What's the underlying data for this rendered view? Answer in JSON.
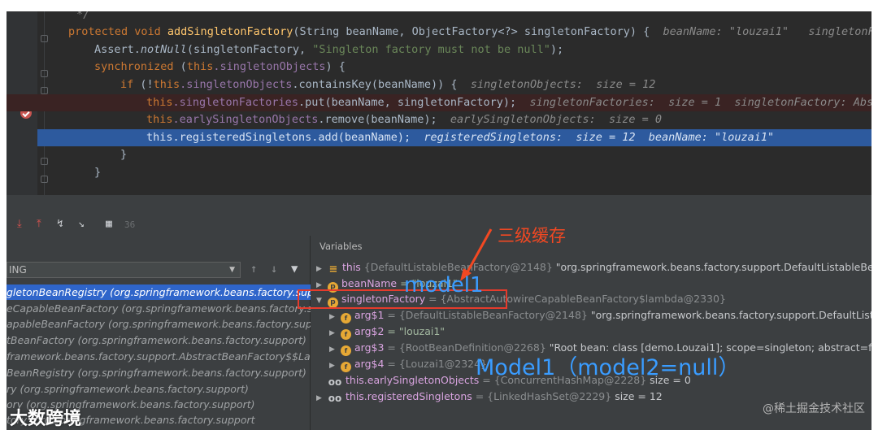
{
  "editor": {
    "lines": [
      {
        "comment": "*/"
      },
      {
        "kw": "protected void ",
        "method": "addSingletonFactory",
        "rest": "(String beanName, ObjectFactory<?> singletonFactory) {",
        "hint": "beanName: \"louzai1\"   singletonFacto"
      },
      {
        "pre": "Assert.",
        "call": "notNull",
        "rest": "(singletonFactory, ",
        "str": "\"Singleton factory must not be null\"",
        "end": ");"
      },
      {
        "kw": "synchronized ",
        "open": "(",
        "this": "this",
        "field": ".singletonObjects",
        "rest": ") {"
      },
      {
        "kw": "if ",
        "open": "(!",
        "this": "this",
        "field": ".singletonObjects",
        "rest": ".containsKey(beanName)) {",
        "hint": "singletonObjects:  size = 12"
      },
      {
        "this": "this",
        "field": ".singletonFactories",
        "rest": ".put(beanName, singletonFactory);",
        "hint": "singletonFactories:  size = 1  singletonFactory: Abstr"
      },
      {
        "this": "this",
        "field": ".earlySingletonObjects",
        "rest": ".remove(beanName);",
        "hint": "earlySingletonObjects:  size = 0"
      },
      {
        "this": "this",
        "field": ".registeredSingletons",
        "rest": ".add(beanName);",
        "hint": "registeredSingletons:  size = 12  beanName: \"louzai1\""
      },
      {
        "rest": "}"
      },
      {
        "rest": "}"
      }
    ]
  },
  "toolbar": {
    "count": "36"
  },
  "frames": {
    "thread": "ING",
    "items": [
      "gletonBeanRegistry (org.springframework.beans.factory.sup",
      "eCapableBeanFactory (org.springframework.beans.factory.sup",
      "apableBeanFactory (org.springframework.beans.factory.supp",
      "tBeanFactory (org.springframework.beans.factory.support)",
      "framework.beans.factory.support.AbstractBeanFactory$$Lar",
      "BeanRegistry (org.springframework.beans.factory.support)",
      "ry (org.springframework.beans.factory.support)",
      "ory (org.springframework.beans.factory.support)",
      "tory (org.springframework.beans.factory.support"
    ]
  },
  "variables": {
    "title": "Variables",
    "rows": [
      {
        "name": "this",
        "ref": "{DefaultListableBeanFactory@2148}",
        "value": "\"org.springframework.beans.factory.support.DefaultListableBean"
      },
      {
        "name": "beanName",
        "ref": "= \"louzai1\"",
        "value": ""
      },
      {
        "name": "singletonFactory",
        "ref": "= {AbstractAutowireCapableBeanFactory$lambda@2330}",
        "value": ""
      },
      {
        "name": "arg$1",
        "ref": "= {DefaultListableBeanFactory@2148}",
        "value": "\"org.springframework.beans.factory.support.DefaultListable"
      },
      {
        "name": "arg$2",
        "ref": "= \"louzai1\"",
        "value": ""
      },
      {
        "name": "arg$3",
        "ref": "= {RootBeanDefinition@2268}",
        "value": "\"Root bean: class [demo.Louzai1]; scope=singleton; abstract=false"
      },
      {
        "name": "arg$4",
        "ref": "= {Louzai1@2324}",
        "value": ""
      },
      {
        "name": "this.earlySingletonObjects",
        "ref": "= {ConcurrentHashMap@2228}",
        "value": "size = 0"
      },
      {
        "name": "this.registeredSingletons",
        "ref": "= {LinkedHashSet@2229}",
        "value": "size = 12"
      }
    ]
  },
  "annotations": {
    "red_label": "三级缓存",
    "blue_a": "model1",
    "blue_b": "Model1（model2=null）",
    "red_color": "#f24822",
    "blue_color": "#3a9cff"
  },
  "branding": {
    "logo": "大数跨境",
    "watermark": "@稀土掘金技术社区"
  }
}
